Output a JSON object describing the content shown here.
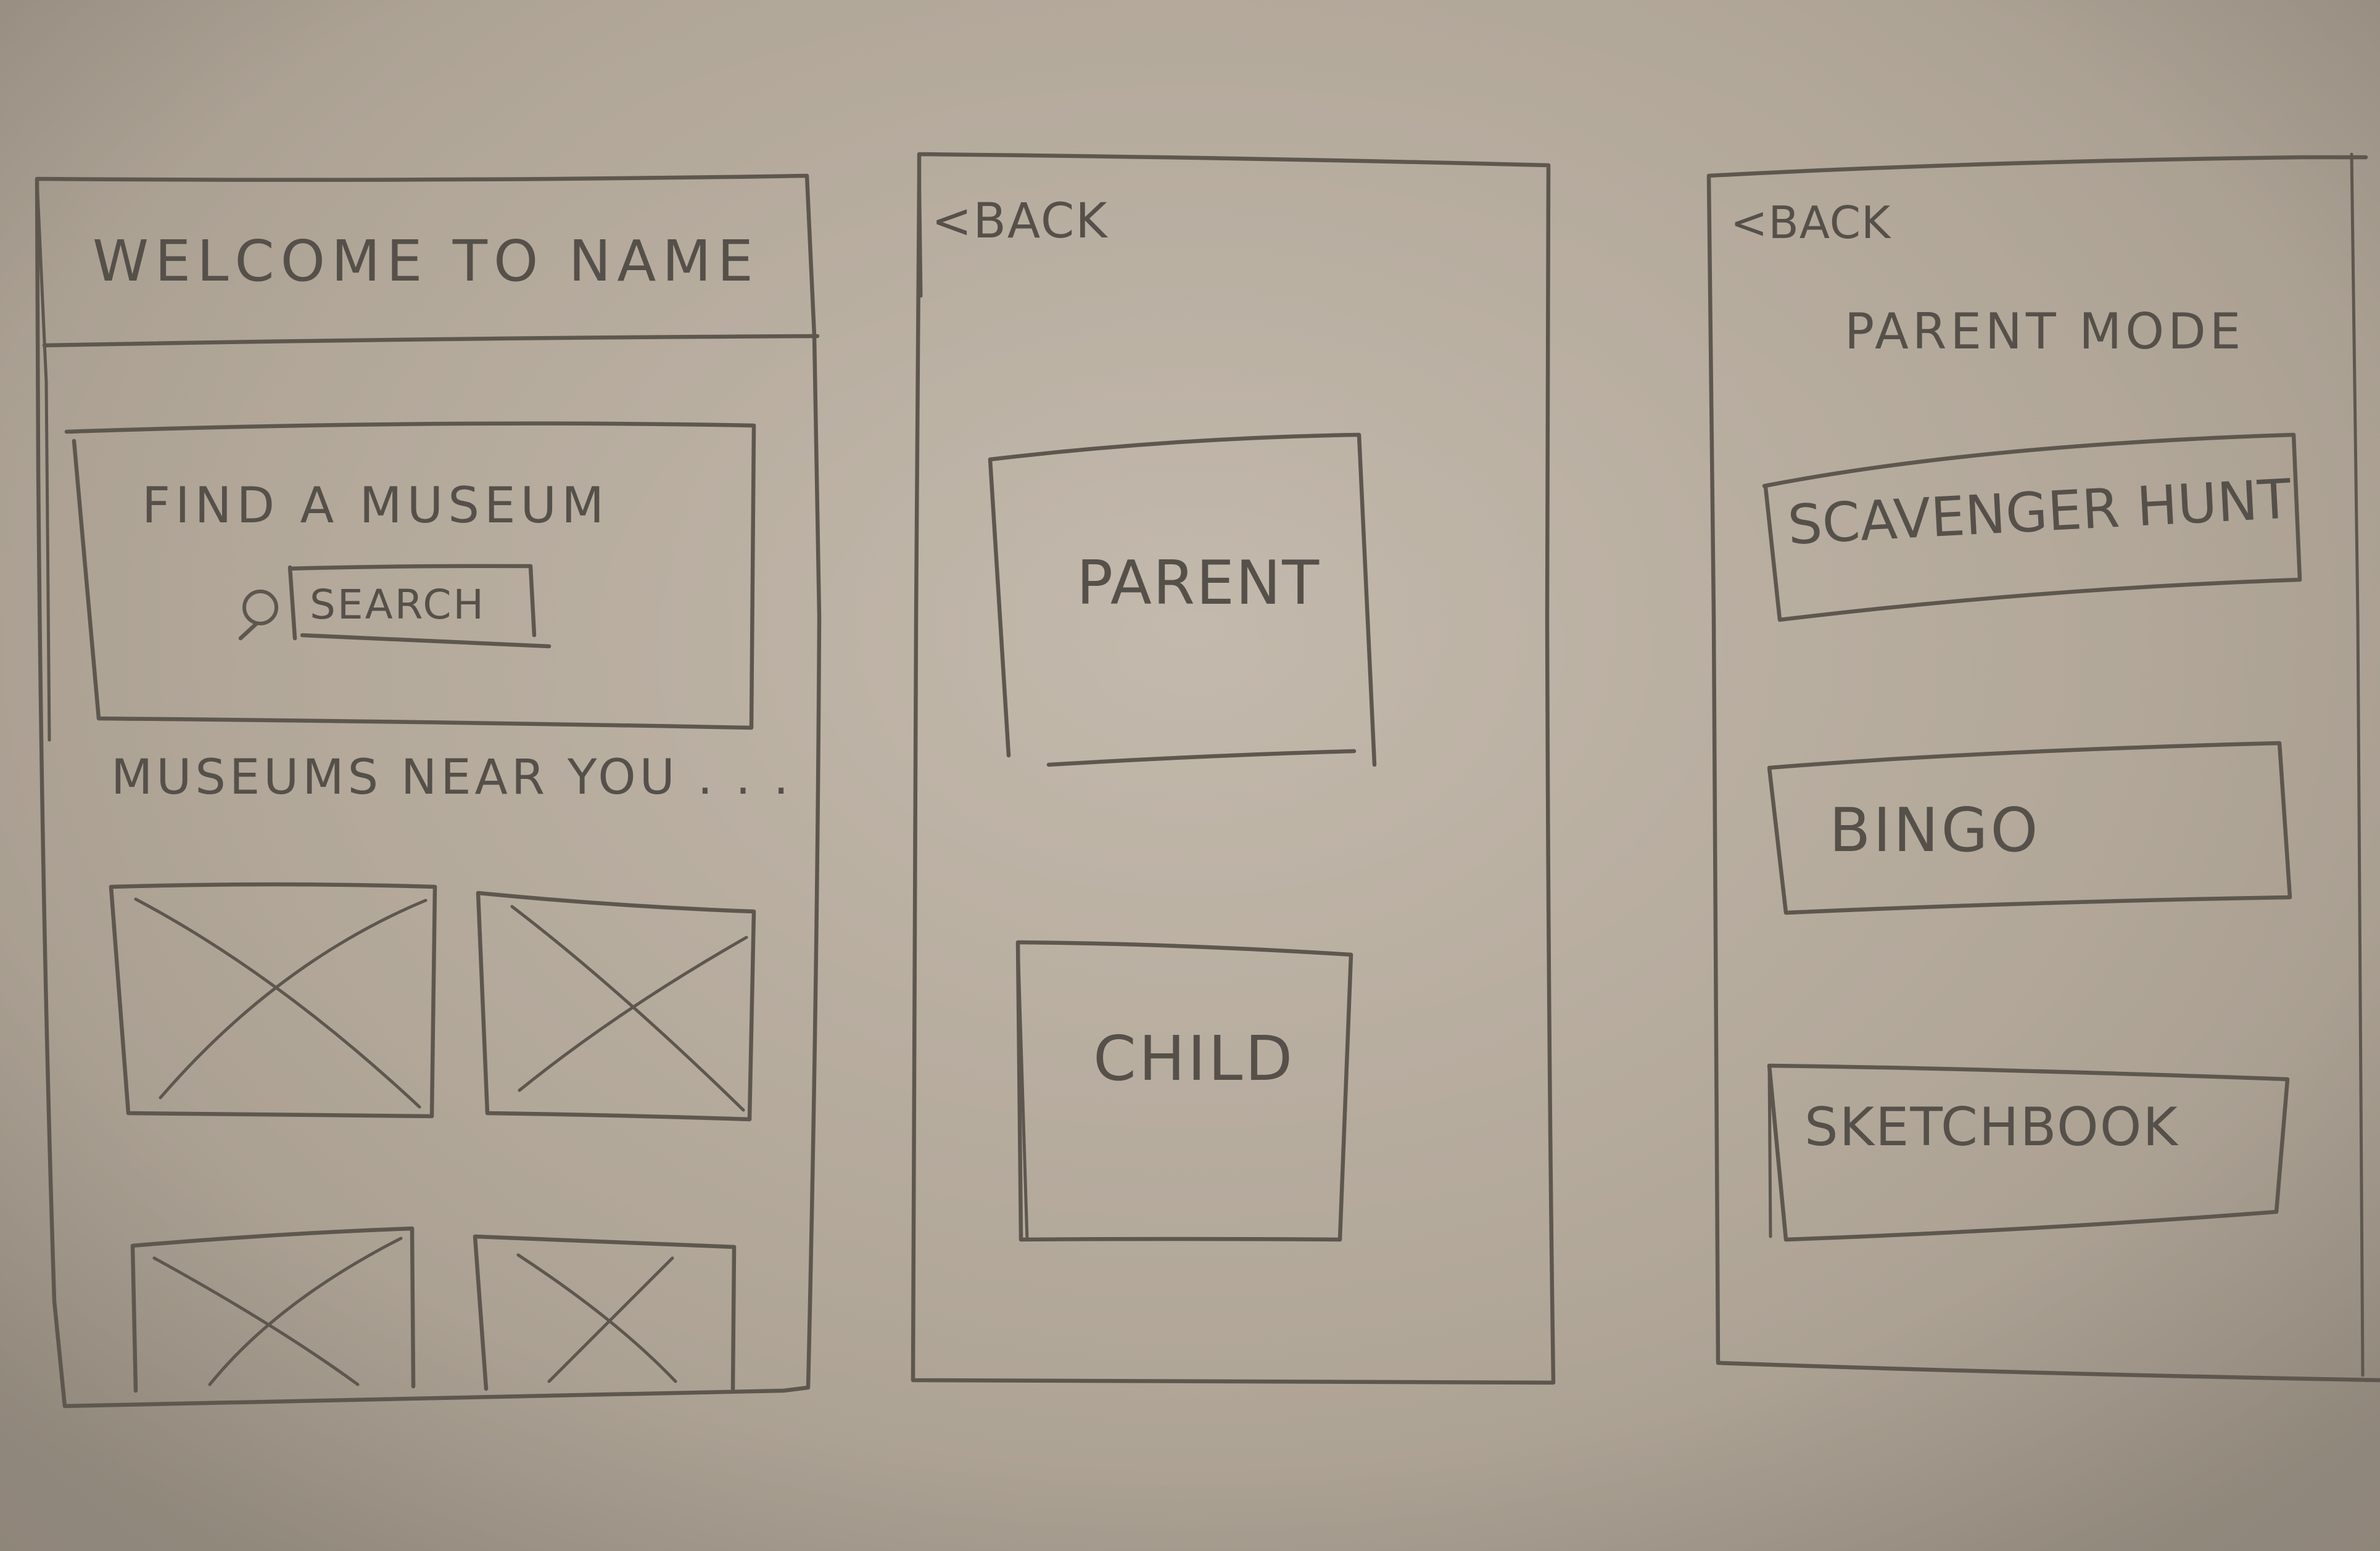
{
  "screen_home": {
    "title": "WELCOME TO NAME",
    "find_heading": "FIND A MUSEUM",
    "search_label": "SEARCH",
    "nearby_heading": "MUSEUMS NEAR YOU . . .",
    "museum_thumbnails": [
      {
        "icon": "image-placeholder-icon"
      },
      {
        "icon": "image-placeholder-icon"
      },
      {
        "icon": "image-placeholder-icon"
      },
      {
        "icon": "image-placeholder-icon"
      }
    ]
  },
  "screen_role": {
    "back_label": "<BACK",
    "parent_label": "PARENT",
    "child_label": "CHILD"
  },
  "screen_parent_mode": {
    "back_label": "<BACK",
    "title": "PARENT MODE",
    "options": [
      {
        "label": "SCAVENGER HUNT"
      },
      {
        "label": "BINGO"
      },
      {
        "label": "SKETCHBOOK"
      }
    ]
  }
}
